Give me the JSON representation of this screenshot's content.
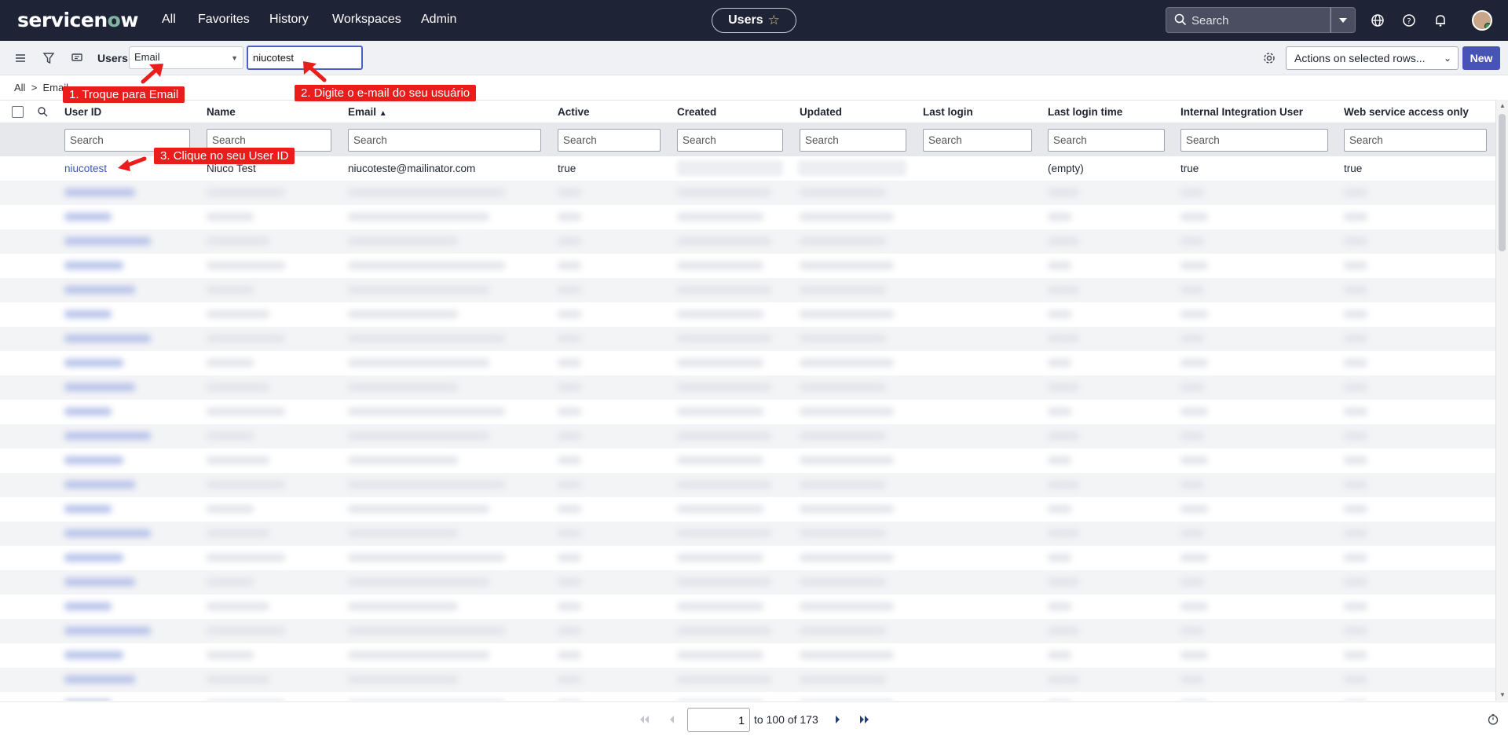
{
  "nav": {
    "logo": "servicenow",
    "links": [
      "All",
      "Favorites",
      "History",
      "Workspaces",
      "Admin"
    ],
    "context_pill": "Users",
    "search_placeholder": "Search"
  },
  "toolbar": {
    "list_title": "Users",
    "field_select": "Email",
    "search_value": "niucotest",
    "actions_label": "Actions on selected rows...",
    "new_label": "New"
  },
  "breadcrumb": [
    "All",
    ">",
    "Email"
  ],
  "table": {
    "columns": [
      "User ID",
      "Name",
      "Email",
      "Active",
      "Created",
      "Updated",
      "Last login",
      "Last login time",
      "Internal Integration User",
      "Web service access only"
    ],
    "sort_column": "Email",
    "search_placeholder": "Search",
    "first_row": {
      "user_id": "niucotest",
      "name": "Niuco Test",
      "email": "niucoteste@mailinator.com",
      "active": "true",
      "last_login_time": "(empty)",
      "internal_integration_user": "true",
      "web_service_access_only": "true"
    }
  },
  "annotations": {
    "step1": "1. Troque para Email",
    "step2": "2. Digite o e-mail do seu usuário",
    "step3": "3. Clique no seu User ID"
  },
  "pagination": {
    "page": "1",
    "range_text": "to 100 of 173"
  },
  "colors": {
    "nav_bg": "#1f2336",
    "accent": "#4754b6",
    "annotation_red": "#ea1d1d",
    "link": "#3c57b5"
  }
}
